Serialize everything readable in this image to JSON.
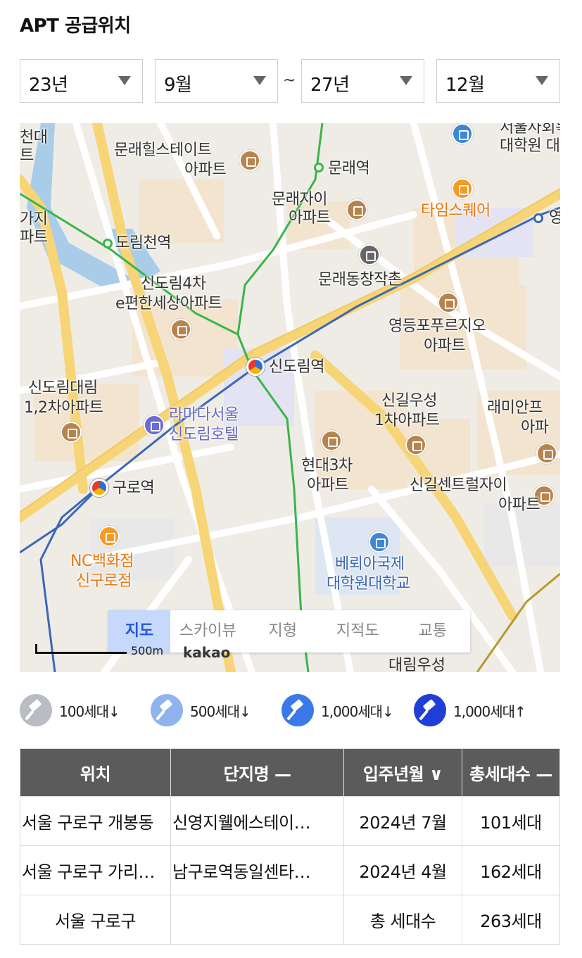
{
  "title": "APT 공급위치",
  "filters": {
    "from_year": "23년",
    "from_month": "9월",
    "separator": "~",
    "to_year": "27년",
    "to_month": "12월"
  },
  "map": {
    "labels": {
      "munrae_hill_1": "문래힐스테이트",
      "munrae_hill_2": "아파트",
      "munrae_station": "문래역",
      "munrae_xi_1": "문래자이",
      "munrae_xi_2": "아파트",
      "times_square": "타임스퀘어",
      "univ_top_1": "서울사회복지",
      "univ_top_2": "대학원 대학",
      "young": "영",
      "dorimcheon": "도림천역",
      "gaji_1": "가지",
      "gaji_2": "파트",
      "left_top_1": "천대",
      "left_top_2": "트",
      "changjakchon": "문래동창작촌",
      "sindorim4_1": "신도림4차",
      "sindorim4_2": "e편한세상아파트",
      "yeongdeungpo_1": "영등포푸르지오",
      "yeongdeungpo_2": "아파트",
      "sindorim_station": "신도림역",
      "daelim_1": "신도림대림",
      "daelim_2": "1,2차아파트",
      "ramada_1": "라마다서울",
      "ramada_2": "신도림호텔",
      "singil_woosung_1": "신길우성",
      "singil_woosung_2": "1차아파트",
      "raemian_1": "래미안프",
      "raemian_2": "아파",
      "hyundai3_1": "현대3차",
      "hyundai3_2": "아파트",
      "guro_station": "구로역",
      "singil_central_1": "신길센트럴자이",
      "singil_central_2": "아파트",
      "nc_1": "NC백화점",
      "nc_2": "신구로점",
      "veritas_1": "베뢰아국제",
      "veritas_2": "대학원대학교",
      "daerim_woosung": "대림우성",
      "scale": "500m",
      "brand": "kakao"
    },
    "tabs": [
      "지도",
      "스카이뷰",
      "지형",
      "지적도",
      "교통"
    ],
    "active_tab": "지도"
  },
  "legend": [
    {
      "label": "100세대↓",
      "color": "#b9bcc2"
    },
    {
      "label": "500세대↓",
      "color": "#8fb3ee"
    },
    {
      "label": "1,000세대↓",
      "color": "#3c79e8"
    },
    {
      "label": "1,000세대↑",
      "color": "#1f3fd8"
    }
  ],
  "table": {
    "headers": [
      "위치",
      "단지명 —",
      "입주년월 ∨",
      "총세대수 —"
    ],
    "rows": [
      [
        "서울 구로구 개봉동",
        "신영지웰에스테이…",
        "2024년 7월",
        "101세대"
      ],
      [
        "서울 구로구 가리…",
        "남구로역동일센타…",
        "2024년 4월",
        "162세대"
      ]
    ],
    "total": {
      "location": "서울 구로구",
      "label": "총 세대수",
      "value": "263세대"
    }
  }
}
